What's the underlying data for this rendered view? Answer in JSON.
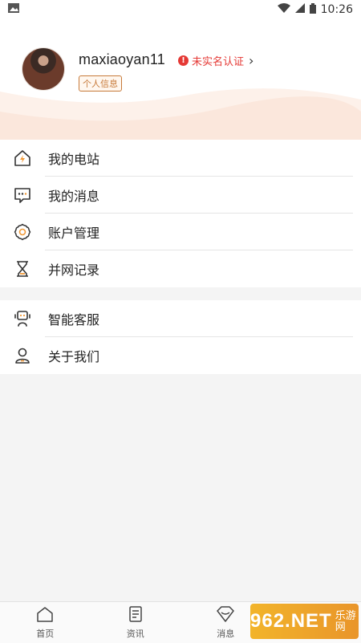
{
  "status_bar": {
    "time": "10:26",
    "battery_icon": "battery-icon"
  },
  "profile": {
    "username": "maxiaoyan11",
    "verify_text": "未实名认证",
    "verify_icon": "!",
    "tag": "个人信息"
  },
  "menu_group_1": [
    {
      "label": "我的电站",
      "icon": "home-bolt-icon"
    },
    {
      "label": "我的消息",
      "icon": "message-icon"
    },
    {
      "label": "账户管理",
      "icon": "flower-gear-icon"
    },
    {
      "label": "并网记录",
      "icon": "hourglass-icon"
    }
  ],
  "menu_group_2": [
    {
      "label": "智能客服",
      "icon": "robot-icon"
    },
    {
      "label": "关于我们",
      "icon": "person-icon"
    }
  ],
  "tabbar": [
    {
      "label": "首页",
      "icon": "home-icon"
    },
    {
      "label": "资讯",
      "icon": "document-icon"
    },
    {
      "label": "消息",
      "icon": "diamond-icon"
    }
  ],
  "watermark": {
    "main": "962.NET",
    "sub": "乐游网"
  },
  "colors": {
    "accent": "#e53935",
    "tag": "#c77a3a",
    "icon": "#333333"
  }
}
